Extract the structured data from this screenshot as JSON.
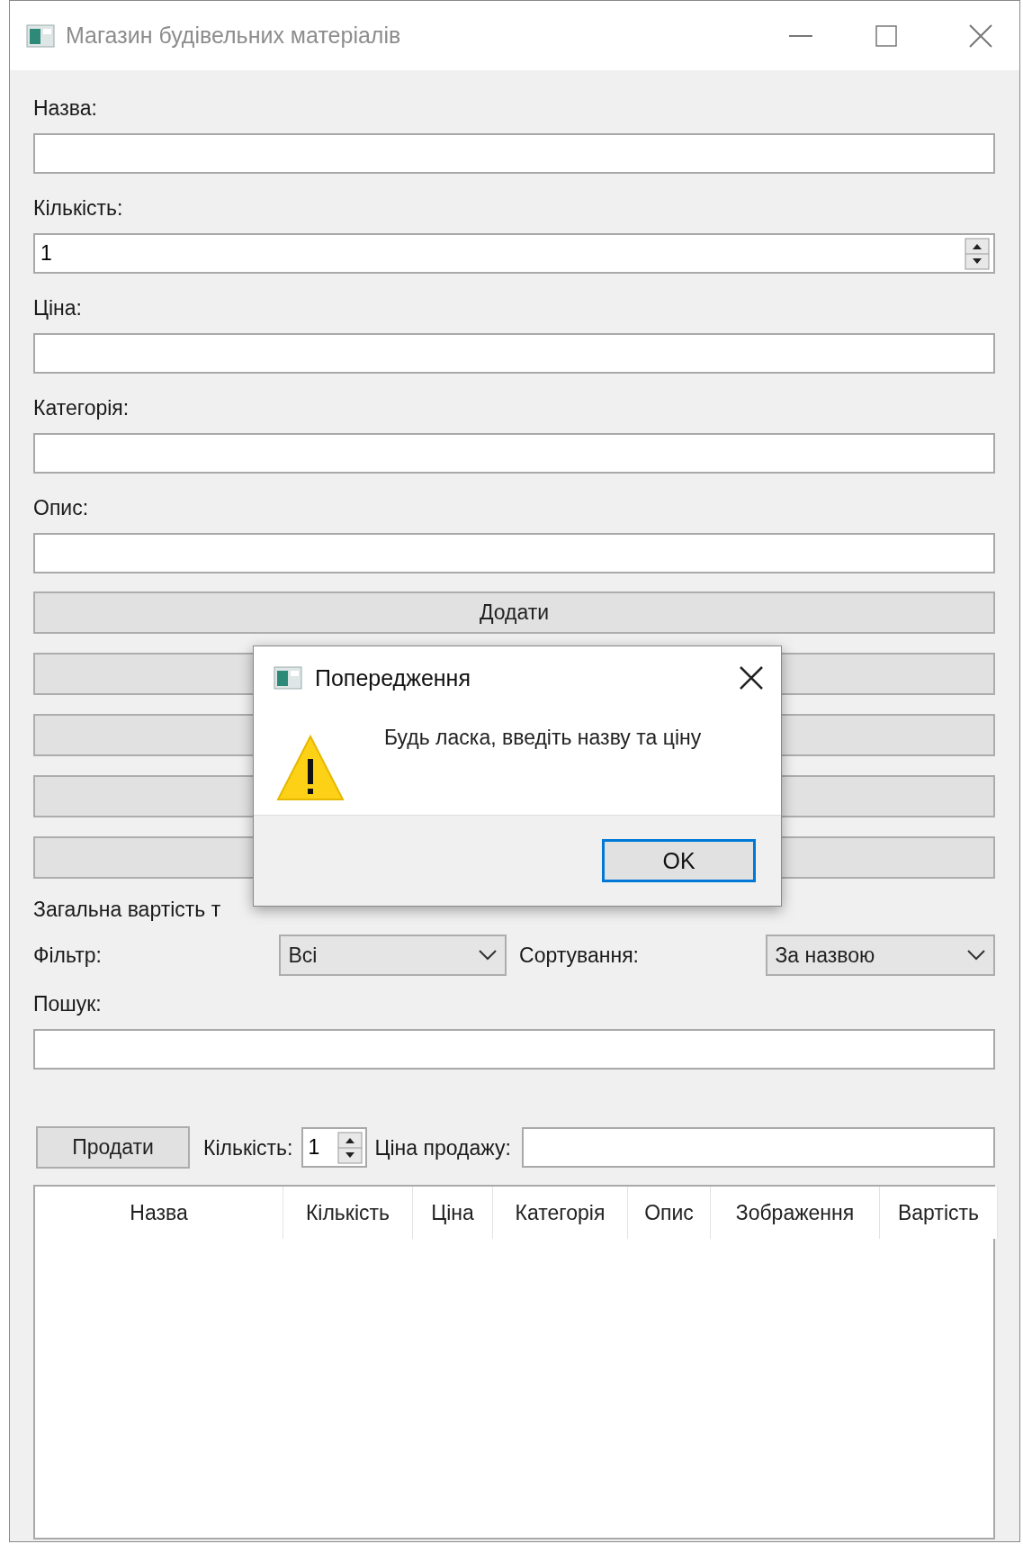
{
  "window": {
    "title": "Магазин будівельних матеріалів"
  },
  "form_fields": [
    {
      "kind": "text",
      "label": "Назва:"
    },
    {
      "kind": "spin",
      "label": "Кількість:",
      "value": "1"
    },
    {
      "kind": "text",
      "label": "Ціна:"
    },
    {
      "kind": "text",
      "label": "Категорія:"
    },
    {
      "kind": "text",
      "label": "Опис:"
    }
  ],
  "action_buttons": [
    {
      "kind": "labeled",
      "label": "Додати"
    },
    {
      "kind": "covered"
    },
    {
      "kind": "covered"
    },
    {
      "kind": "covered"
    },
    {
      "kind": "covered"
    }
  ],
  "total_label": "Загальна вартість т",
  "filter": {
    "label": "Фільтр:",
    "value": "Всі"
  },
  "sort": {
    "label": "Сортування:",
    "value": "За назвою"
  },
  "search": {
    "label": "Пошук:"
  },
  "sale_bar": {
    "button": "Продати",
    "quantity_label": "Кількість:",
    "quantity": "1",
    "price_label": "Ціна продажу:"
  },
  "table": {
    "columns": [
      "Назва",
      "Кількість",
      "Ціна",
      "Категорія",
      "Опис",
      "Зображення",
      "Вартість"
    ]
  },
  "dialog": {
    "title": "Попередження",
    "message": "Будь ласка, введіть назву та ціну",
    "button": "OK"
  }
}
